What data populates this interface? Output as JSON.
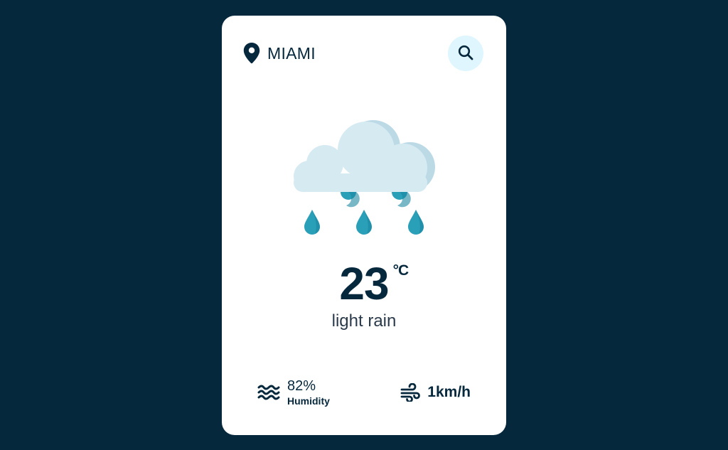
{
  "location": {
    "city": "MIAMI",
    "icon": "map-pin-icon"
  },
  "search": {
    "icon": "search-icon"
  },
  "weather": {
    "icon": "cloud-rain-icon",
    "temperature": "23",
    "unit": "°C",
    "description": "light rain"
  },
  "details": {
    "humidity": {
      "icon": "water-waves-icon",
      "value": "82%",
      "label": "Humidity"
    },
    "wind": {
      "icon": "wind-icon",
      "value": "1km/h"
    }
  },
  "colors": {
    "background": "#06283d",
    "card": "#ffffff",
    "search_button": "#dff6ff",
    "text": "#06283d",
    "cloud": "#d6eaf2",
    "cloud_shadow": "#bcd9e6",
    "rain_drop": "#2a9fb8"
  }
}
